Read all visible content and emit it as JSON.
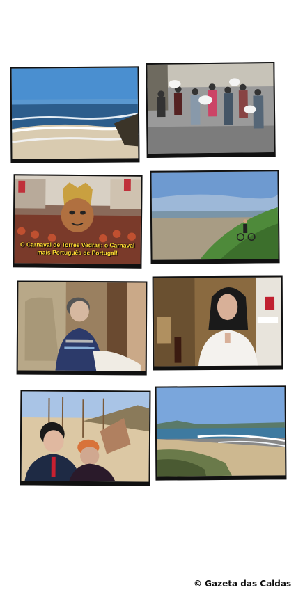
{
  "photos": [
    {
      "subject": "beach-waves"
    },
    {
      "subject": "pillow-fight-crowd"
    },
    {
      "subject": "carnival-parade",
      "caption": "O Carnaval de Torres Vedras: o Carnaval mais Português de Portugal!"
    },
    {
      "subject": "coastal-cyclist"
    },
    {
      "subject": "elderly-woman-sewing"
    },
    {
      "subject": "woman-in-shop"
    },
    {
      "subject": "couple-on-beach"
    },
    {
      "subject": "coastal-dunes"
    }
  ],
  "credit": {
    "text": "© Gazeta das Caldas"
  }
}
